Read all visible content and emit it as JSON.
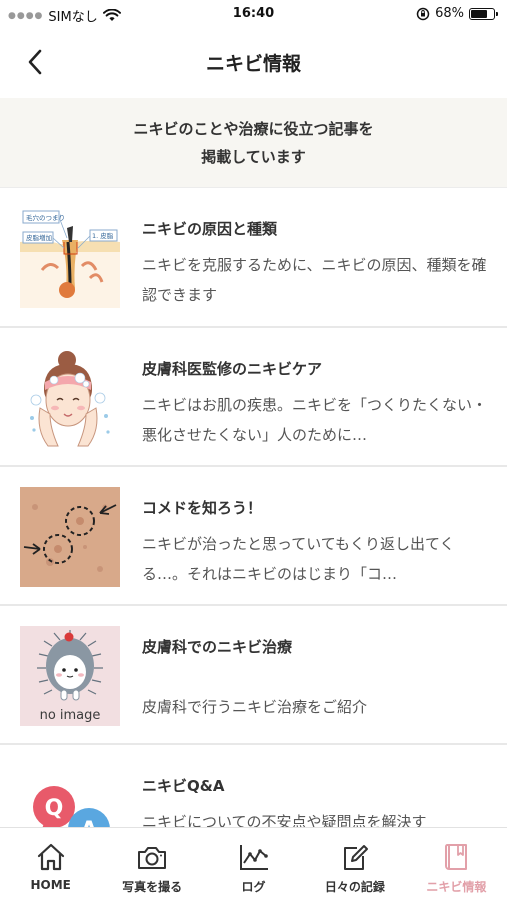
{
  "status": {
    "carrier": "SIMなし",
    "time": "16:40",
    "battery": "68%"
  },
  "nav": {
    "title": "ニキビ情報"
  },
  "intro": {
    "line1": "ニキビのことや治療に役立つ記事を",
    "line2": "掲載しています"
  },
  "articles": [
    {
      "title": "ニキビの原因と種類",
      "desc": "ニキビを克服するために、ニキビの原因、種類を確認できます",
      "thumb_labels": [
        "毛穴のつまり",
        "皮脂増加",
        "1. 皮脂"
      ]
    },
    {
      "title": "皮膚科医監修のニキビケア",
      "desc": "ニキビはお肌の疾患。ニキビを「つくりたくない・悪化させたくない」人のために…"
    },
    {
      "title": "コメドを知ろう！",
      "desc": "ニキビが治ったと思っていてもくり返し出てくる…。それはニキビのはじまり「コ…"
    },
    {
      "title": "皮膚科でのニキビ治療",
      "desc": "皮膚科で行うニキビ治療をご紹介",
      "thumb_label": "no image"
    },
    {
      "title": "ニキビQ&A",
      "desc": "ニキビについての不安点や疑問点を解決す",
      "thumb_q": "Q",
      "thumb_a": "A"
    }
  ],
  "tabs": [
    {
      "label": "HOME",
      "icon": "home-icon"
    },
    {
      "label": "写真を撮る",
      "icon": "camera-icon"
    },
    {
      "label": "ログ",
      "icon": "chart-icon"
    },
    {
      "label": "日々の記録",
      "icon": "edit-icon"
    },
    {
      "label": "ニキビ情報",
      "icon": "book-icon",
      "active": true
    }
  ],
  "colors": {
    "accent": "#e2a0a9",
    "intro_bg": "#f7f6f2"
  }
}
